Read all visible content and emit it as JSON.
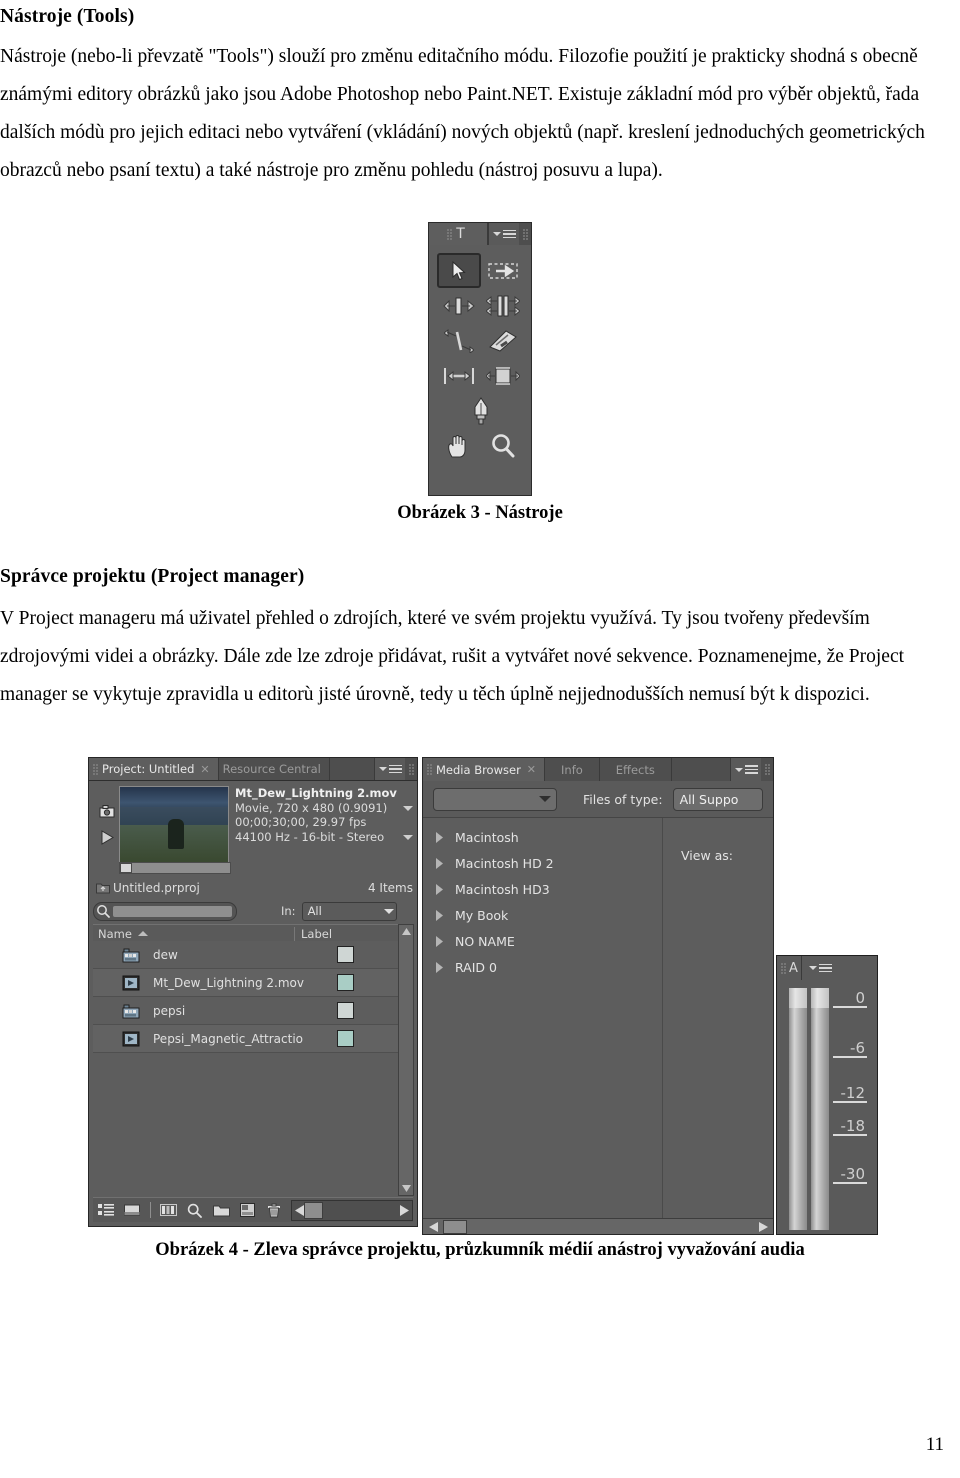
{
  "document": {
    "heading1": "Nástroje (Tools)",
    "paragraph1": "Nástroje (nebo-li převzatě \"Tools\") slouží pro změnu editačního módu. Filozofie použití je prakticky shodná s obecně známými editory obrázků jako jsou Adobe Photoshop nebo Paint.NET. Existuje základní mód pro výběr objektů, řada dalších módù pro jejich editaci nebo vytváření (vkládání) nových objektů (např. kreslení jednoduchých geometrických obrazců nebo psaní textu) a také nástroje pro změnu pohledu (nástroj posuvu a lupa).",
    "figure3_caption": "Obrázek 3 - Nástroje",
    "heading2": "Správce projektu (Project manager)",
    "paragraph2_line1": "V Project manageru má uživatel přehled o zdrojích, které ve svém projektu využívá. Ty jsou tvořeny především zdrojovými videi a obrázky. Dále zde lze zdroje přidávat, rušit a vytvářet nové sekvence. Poznamenejme, že Project manager se vykytuje zpravidla u editorù jisté úrovně, tedy u těch úplně nejjednodušších nemusí být k dispozici.",
    "figure4_caption": "Obrázek 4 - Zleva správce projektu, průzkumník médií anástroj vyvažování audia",
    "page_number": "11"
  },
  "tools_panel": {
    "type_tool_label": "T",
    "tools": [
      {
        "name": "selection-tool",
        "selected": true
      },
      {
        "name": "track-select-tool",
        "selected": false
      },
      {
        "name": "ripple-edit-tool",
        "selected": false
      },
      {
        "name": "rolling-edit-tool",
        "selected": false
      },
      {
        "name": "rate-stretch-tool",
        "selected": false
      },
      {
        "name": "razor-tool",
        "selected": false
      },
      {
        "name": "slip-tool",
        "selected": false
      },
      {
        "name": "slide-tool",
        "selected": false
      },
      {
        "name": "pen-tool",
        "selected": false
      },
      {
        "name": "hand-tool",
        "selected": false
      },
      {
        "name": "zoom-tool",
        "selected": false
      }
    ]
  },
  "project_panel": {
    "tabs": [
      {
        "label": "Project: Untitled",
        "active": true,
        "closable": true
      },
      {
        "label": "Resource Central",
        "active": false,
        "closable": false
      }
    ],
    "preview": {
      "clip_name": "Mt_Dew_Lightning 2.mov",
      "format": "Movie, 720 x 480 (0.9091)",
      "duration": "00;00;30;00, 29.97 fps",
      "audio": "44100 Hz - 16-bit - Stereo"
    },
    "project_file": "Untitled.prproj",
    "item_count": "4 Items",
    "search_placeholder": "",
    "in_label": "In:",
    "in_value": "All",
    "columns": [
      "Name",
      "Label"
    ],
    "rows": [
      {
        "name": "dew",
        "icon": "bin-icon",
        "label_color": "#cfd6d4"
      },
      {
        "name": "Mt_Dew_Lightning 2.mov",
        "icon": "movie-icon",
        "label_color": "#a9cdc5"
      },
      {
        "name": "pepsi",
        "icon": "bin-icon",
        "label_color": "#cfd6d4"
      },
      {
        "name": "Pepsi_Magnetic_Attractio",
        "icon": "movie-icon",
        "label_color": "#a9cdc5"
      }
    ],
    "footer_icons": [
      "list-view-icon",
      "icon-view-icon",
      "automate-to-sequence-icon",
      "find-icon",
      "new-bin-icon",
      "new-item-icon",
      "delete-icon"
    ]
  },
  "media_browser": {
    "tabs": [
      {
        "label": "Media Browser",
        "active": true,
        "closable": true
      },
      {
        "label": "Info",
        "active": false,
        "closable": false
      },
      {
        "label": "Effects",
        "active": false,
        "closable": false
      }
    ],
    "directory_value": "",
    "files_of_type_label": "Files of type:",
    "files_of_type_value": "All Suppo",
    "view_as_label": "View as:",
    "tree_items": [
      "Macintosh",
      "Macintosh HD 2",
      "Macintosh HD3",
      "My Book",
      "NO NAME",
      "RAID 0"
    ]
  },
  "audio_panel": {
    "tab_label": "A",
    "scale_marks": [
      "0",
      "-6",
      "-12",
      "-18",
      "-30"
    ],
    "channels": 2
  },
  "colors": {
    "panel_bg": "#5d5d5d",
    "tab_bg": "#4e4e4e",
    "tab_active_bg": "#5e5e5e",
    "text": "#e0e0e0",
    "label_teal": "#a9cdc5",
    "label_grey": "#cfd6d4"
  }
}
